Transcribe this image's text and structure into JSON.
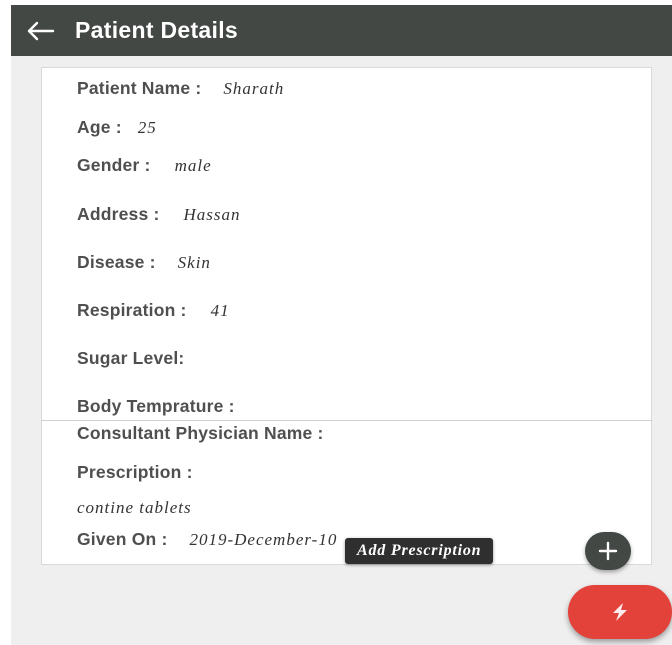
{
  "header": {
    "title": "Patient Details",
    "back_icon": "arrow-left-icon"
  },
  "patient": {
    "name_label": "Patient Name :",
    "name_value": "Sharath",
    "age_label": "Age :",
    "age_value": "25",
    "gender_label": "Gender :",
    "gender_value": "male",
    "address_label": "Address :",
    "address_value": "Hassan",
    "disease_label": "Disease :",
    "disease_value": "Skin",
    "respiration_label": "Respiration :",
    "respiration_value": "41",
    "sugar_label": "Sugar Level:",
    "temperature_label": "Body Temprature :"
  },
  "prescription": {
    "physician_label": "Consultant Physician Name :",
    "prescription_label": "Prescription :",
    "prescription_value": "contine tablets",
    "given_on_label": "Given On :",
    "given_on_value": "2019-December-10"
  },
  "fab": {
    "add_prescription_label": "Add Prescription",
    "mini_icon": "plus-icon",
    "main_icon": "lightning-icon"
  },
  "colors": {
    "appbar": "#434845",
    "fab_main": "#e2423a",
    "background": "#efefef"
  }
}
